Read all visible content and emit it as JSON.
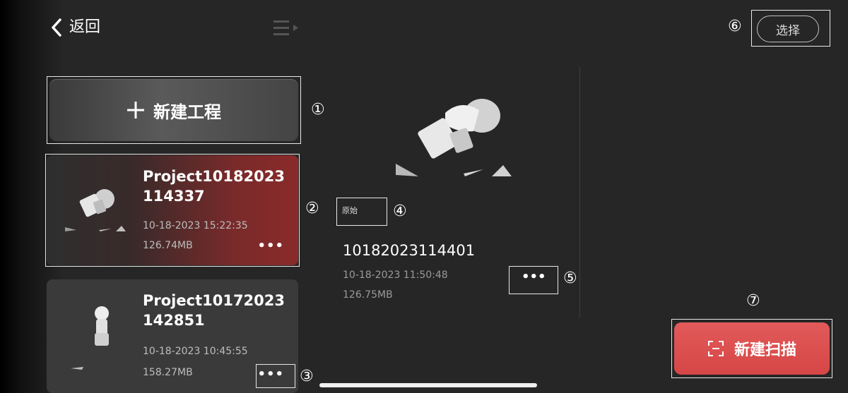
{
  "header": {
    "back_label": "返回",
    "select_label": "选择"
  },
  "new_project": {
    "label": "新建工程"
  },
  "projects": [
    {
      "title": "Project10182023114337",
      "date": "10-18-2023 15:22:35",
      "size": "126.74MB",
      "more": "•••"
    },
    {
      "title": "Project10172023142851",
      "date": "10-18-2023 10:45:55",
      "size": "158.27MB",
      "more": "•••"
    }
  ],
  "scan": {
    "tag": "原始",
    "name": "10182023114401",
    "date": "10-18-2023 11:50:48",
    "size": "126.75MB",
    "more": "•••"
  },
  "new_scan": {
    "label": "新建扫描"
  },
  "annotations": [
    "①",
    "②",
    "③",
    "④",
    "⑤",
    "⑥",
    "⑦"
  ],
  "icons": [
    "chevron-left-icon",
    "menu-collapse-icon",
    "plus-icon",
    "scan-frame-icon",
    "more-dots-icon"
  ],
  "colors": {
    "background": "#262626",
    "selected_card_accent": "#8a2a2a",
    "new_scan_button": "#d64646"
  }
}
